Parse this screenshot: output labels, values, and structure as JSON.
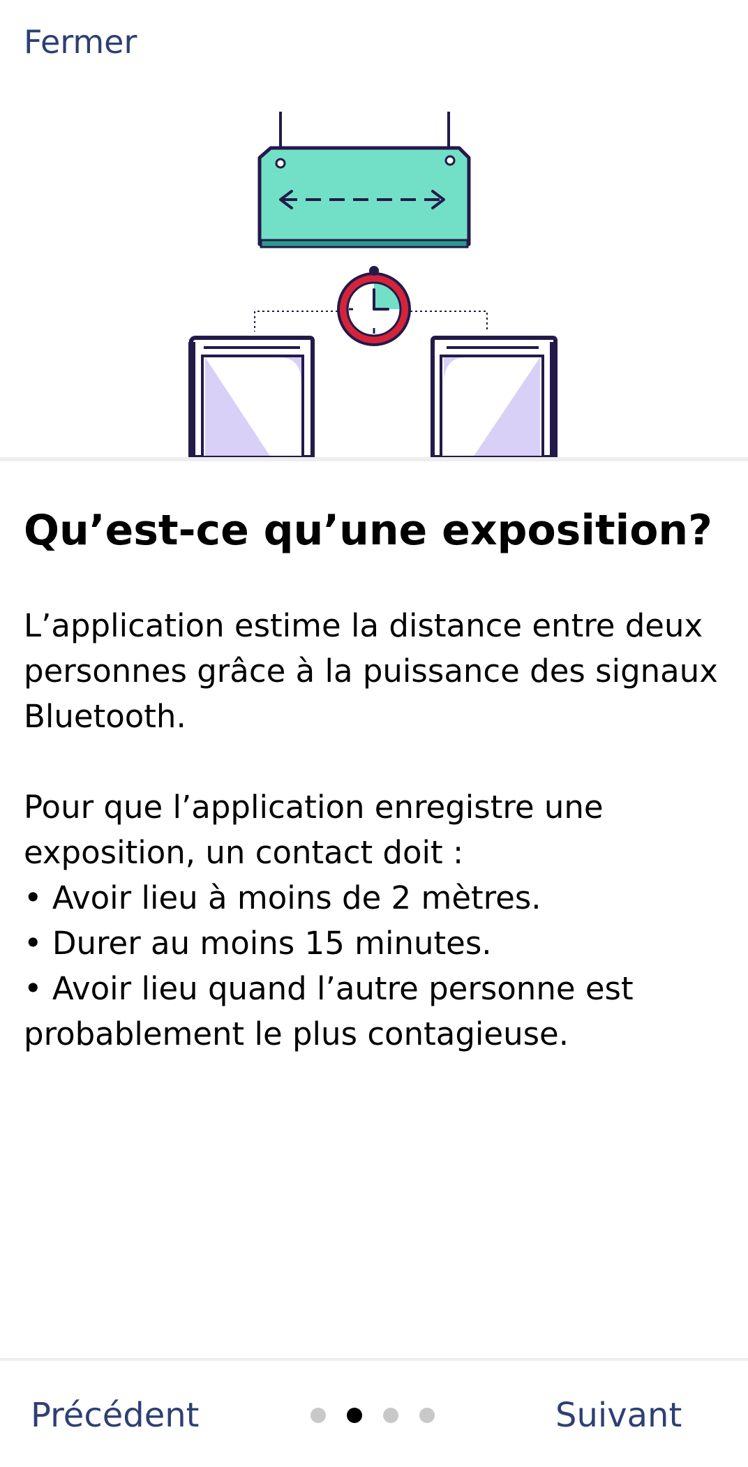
{
  "header": {
    "close_label": "Fermer"
  },
  "content": {
    "title": "Qu’est-ce qu’une exposition?",
    "paragraph1": "L’application estime la distance entre deux personnes grâce à la puissance des signaux Bluetooth.",
    "paragraph2_intro": "Pour que l’application enregistre une exposition, un contact doit :",
    "bullets": [
      "• Avoir lieu à moins de 2 mètres.",
      "• Durer au moins 15 minutes.",
      "• Avoir lieu quand l’autre personne est probablement le plus contagieuse."
    ]
  },
  "footer": {
    "previous_label": "Précédent",
    "next_label": "Suivant",
    "pager": {
      "total": 4,
      "current": 2
    }
  },
  "colors": {
    "link": "#2e3f73",
    "sign_fill": "#72e0c6",
    "outline": "#231a4a",
    "clock_ring": "#d5243a",
    "screen_fill": "#d8d0f7",
    "divider": "#eeeeee",
    "dot_inactive": "#c8c8c8",
    "dot_active": "#000000"
  },
  "illustration": {
    "icons": [
      "distance-sign-icon",
      "clock-icon",
      "phone-icon",
      "phone-icon"
    ]
  }
}
